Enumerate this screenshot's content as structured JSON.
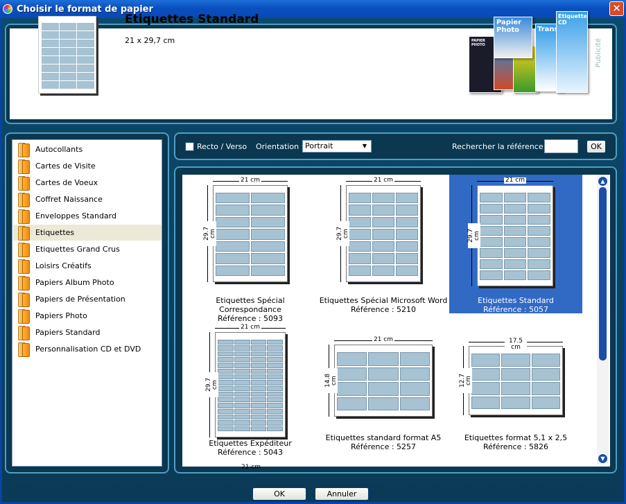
{
  "window": {
    "title": "Choisir le format de papier",
    "close": "✕"
  },
  "header": {
    "title": "Etiquettes Standard",
    "dims": "21 x 29,7 cm",
    "ad_label": "Publicité",
    "ad_texts": [
      "Papier Photo",
      "Etiquettes CD",
      "Transfert",
      "PAPIER PHOTO"
    ]
  },
  "categories": [
    "Autocollants",
    "Cartes de Visite",
    "Cartes de Voeux",
    "Coffret Naissance",
    "Enveloppes Standard",
    "Etiquettes",
    "Etiquettes Grand Crus",
    "Loisirs Créatifs",
    "Papiers Album Photo",
    "Papiers de Présentation",
    "Papiers Photo",
    "Papiers Standard",
    "Personnalisation CD et DVD"
  ],
  "selected_category": "Etiquettes",
  "toolbar": {
    "recto_label": "Recto / Verso",
    "recto_checked": false,
    "orientation_label": "Orientation :",
    "orientation_value": "Portrait",
    "search_label": "Rechercher la référence :",
    "search_value": "",
    "ok_label": "OK"
  },
  "formats": [
    {
      "name": "Etiquettes Spécial Correspondance",
      "ref": "Référence : 5093",
      "width": "21 cm",
      "height": "29.7 cm",
      "cols": 2,
      "rows": 7,
      "selected": false
    },
    {
      "name": "Etiquettes Spécial Microsoft Word",
      "ref": "Référence : 5210",
      "width": "21 cm",
      "height": "29.7 cm",
      "cols": 3,
      "rows": 7,
      "selected": false
    },
    {
      "name": "Etiquettes Standard",
      "ref": "Référence : 5057",
      "width": "21 cm",
      "height": "29.7 cm",
      "cols": 3,
      "rows": 8,
      "selected": true
    },
    {
      "name": "Etiquettes Expéditeur",
      "ref": "Référence : 5043",
      "width": "21 cm",
      "height": "29.7 cm",
      "cols": 4,
      "rows": 16,
      "selected": false
    },
    {
      "name": "Etiquettes standard format A5",
      "ref": "Référence : 5257",
      "width": "21 cm",
      "height": "14.8 cm",
      "cols": 3,
      "rows": 4,
      "selected": false
    },
    {
      "name": "Etiquettes format 5,1 x 2,5",
      "ref": "Référence : 5826",
      "width": "17.5 cm",
      "height": "12.7 cm",
      "cols": 3,
      "rows": 4,
      "selected": false
    }
  ],
  "partial_label": "21 cm",
  "footer": {
    "ok": "OK",
    "cancel": "Annuler"
  }
}
